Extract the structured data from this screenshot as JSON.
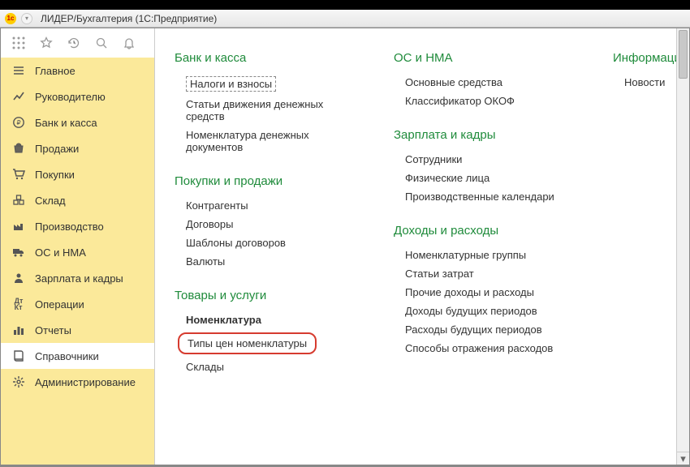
{
  "window": {
    "title": "ЛИДЕР/Бухгалтерия  (1С:Предприятие)"
  },
  "sidebar": {
    "items": [
      {
        "label": "Главное"
      },
      {
        "label": "Руководителю"
      },
      {
        "label": "Банк и касса"
      },
      {
        "label": "Продажи"
      },
      {
        "label": "Покупки"
      },
      {
        "label": "Склад"
      },
      {
        "label": "Производство"
      },
      {
        "label": "ОС и НМА"
      },
      {
        "label": "Зарплата и кадры"
      },
      {
        "label": "Операции"
      },
      {
        "label": "Отчеты"
      },
      {
        "label": "Справочники"
      },
      {
        "label": "Администрирование"
      }
    ]
  },
  "main": {
    "col1": {
      "sec1": {
        "title": "Банк и касса",
        "links": [
          "Налоги и взносы",
          "Статьи движения денежных средств",
          "Номенклатура денежных документов"
        ]
      },
      "sec2": {
        "title": "Покупки и продажи",
        "links": [
          "Контрагенты",
          "Договоры",
          "Шаблоны договоров",
          "Валюты"
        ]
      },
      "sec3": {
        "title": "Товары и услуги",
        "links": [
          "Номенклатура",
          "Типы цен номенклатуры",
          "Склады"
        ]
      }
    },
    "col2": {
      "sec1": {
        "title": "ОС и НМА",
        "links": [
          "Основные средства",
          "Классификатор ОКОФ"
        ]
      },
      "sec2": {
        "title": "Зарплата и кадры",
        "links": [
          "Сотрудники",
          "Физические лица",
          "Производственные календари"
        ]
      },
      "sec3": {
        "title": "Доходы и расходы",
        "links": [
          "Номенклатурные группы",
          "Статьи затрат",
          "Прочие доходы и расходы",
          "Доходы будущих периодов",
          "Расходы будущих периодов",
          "Способы отражения расходов"
        ]
      }
    },
    "col3": {
      "sec1": {
        "title": "Информация",
        "links": [
          "Новости"
        ]
      }
    }
  }
}
